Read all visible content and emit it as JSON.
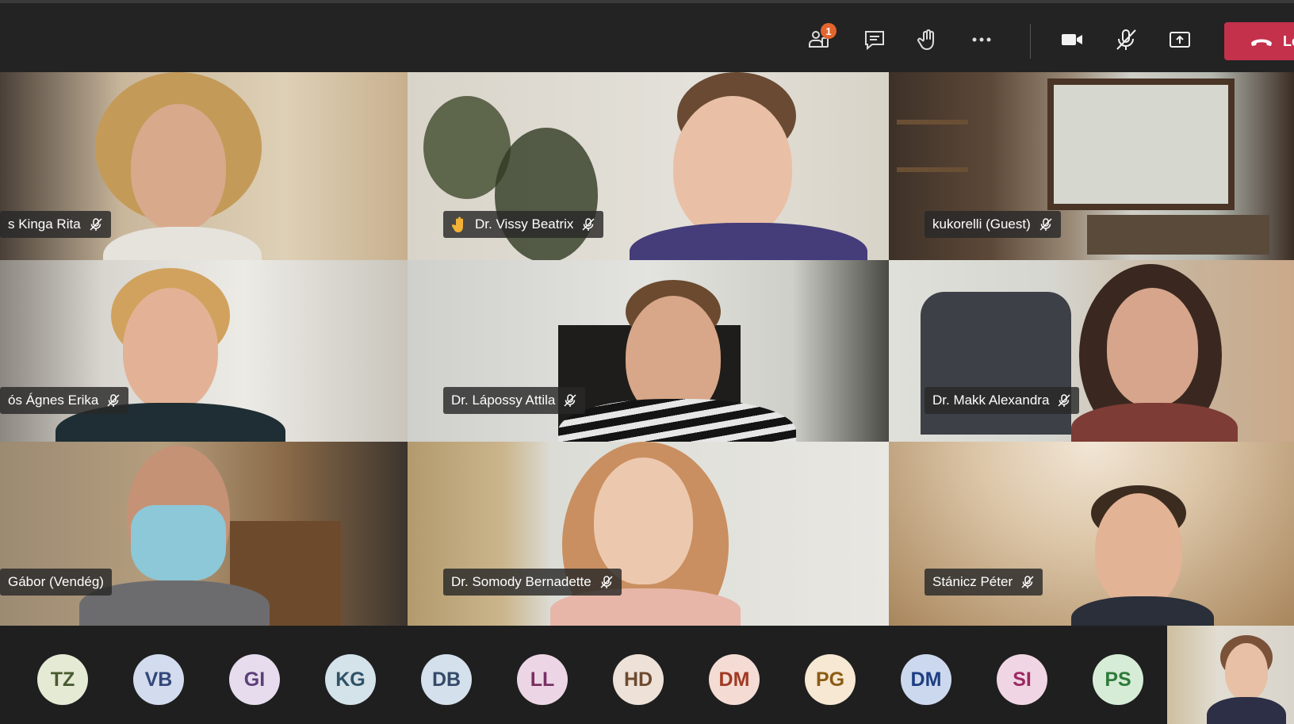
{
  "toolbar": {
    "participants_badge": "1",
    "leave_label": "Le",
    "icons": [
      "participants-icon",
      "chat-icon",
      "raise-hand-icon",
      "more-options-icon",
      "camera-icon",
      "mic-muted-icon",
      "share-screen-icon",
      "phone-hangup-icon"
    ]
  },
  "tiles": [
    {
      "name": "s Kinga Rita",
      "muted": true
    },
    {
      "name": "Dr. Vissy Beatrix",
      "muted": true,
      "hand_raised": true
    },
    {
      "name": "kukorelli (Guest)",
      "muted": true
    },
    {
      "name": "ós Ágnes Erika",
      "muted": true
    },
    {
      "name": "Dr. Lápossy Attila",
      "muted": true
    },
    {
      "name": "Dr. Makk Alexandra",
      "muted": true
    },
    {
      "name": "Gábor (Vendég)",
      "muted": false
    },
    {
      "name": "Dr. Somody Bernadette",
      "muted": true
    },
    {
      "name": "Stánicz Péter",
      "muted": true
    }
  ],
  "roster": [
    {
      "initials": "TZ",
      "bg": "#e4ead4",
      "fg": "#4a5a30"
    },
    {
      "initials": "VB",
      "bg": "#d2dcee",
      "fg": "#33477a"
    },
    {
      "initials": "GI",
      "bg": "#e6dcee",
      "fg": "#5c3f78"
    },
    {
      "initials": "KG",
      "bg": "#d4e2ea",
      "fg": "#2f5265"
    },
    {
      "initials": "DB",
      "bg": "#d4e0ec",
      "fg": "#344a68"
    },
    {
      "initials": "LL",
      "bg": "#ecd6e6",
      "fg": "#7a2f62"
    },
    {
      "initials": "HD",
      "bg": "#eee2d8",
      "fg": "#6e4a30"
    },
    {
      "initials": "DM",
      "bg": "#f4dcd4",
      "fg": "#a03a24"
    },
    {
      "initials": "PG",
      "bg": "#f6e8d2",
      "fg": "#8c5a14"
    },
    {
      "initials": "DM",
      "bg": "#ccd8ee",
      "fg": "#1e3e82"
    },
    {
      "initials": "SI",
      "bg": "#f0d6e4",
      "fg": "#9c2a62"
    },
    {
      "initials": "PS",
      "bg": "#d6ecd6",
      "fg": "#2e7a3a"
    }
  ],
  "colors": {
    "leave": "#c4314b",
    "badge": "#e3642d",
    "bar": "#232323"
  }
}
